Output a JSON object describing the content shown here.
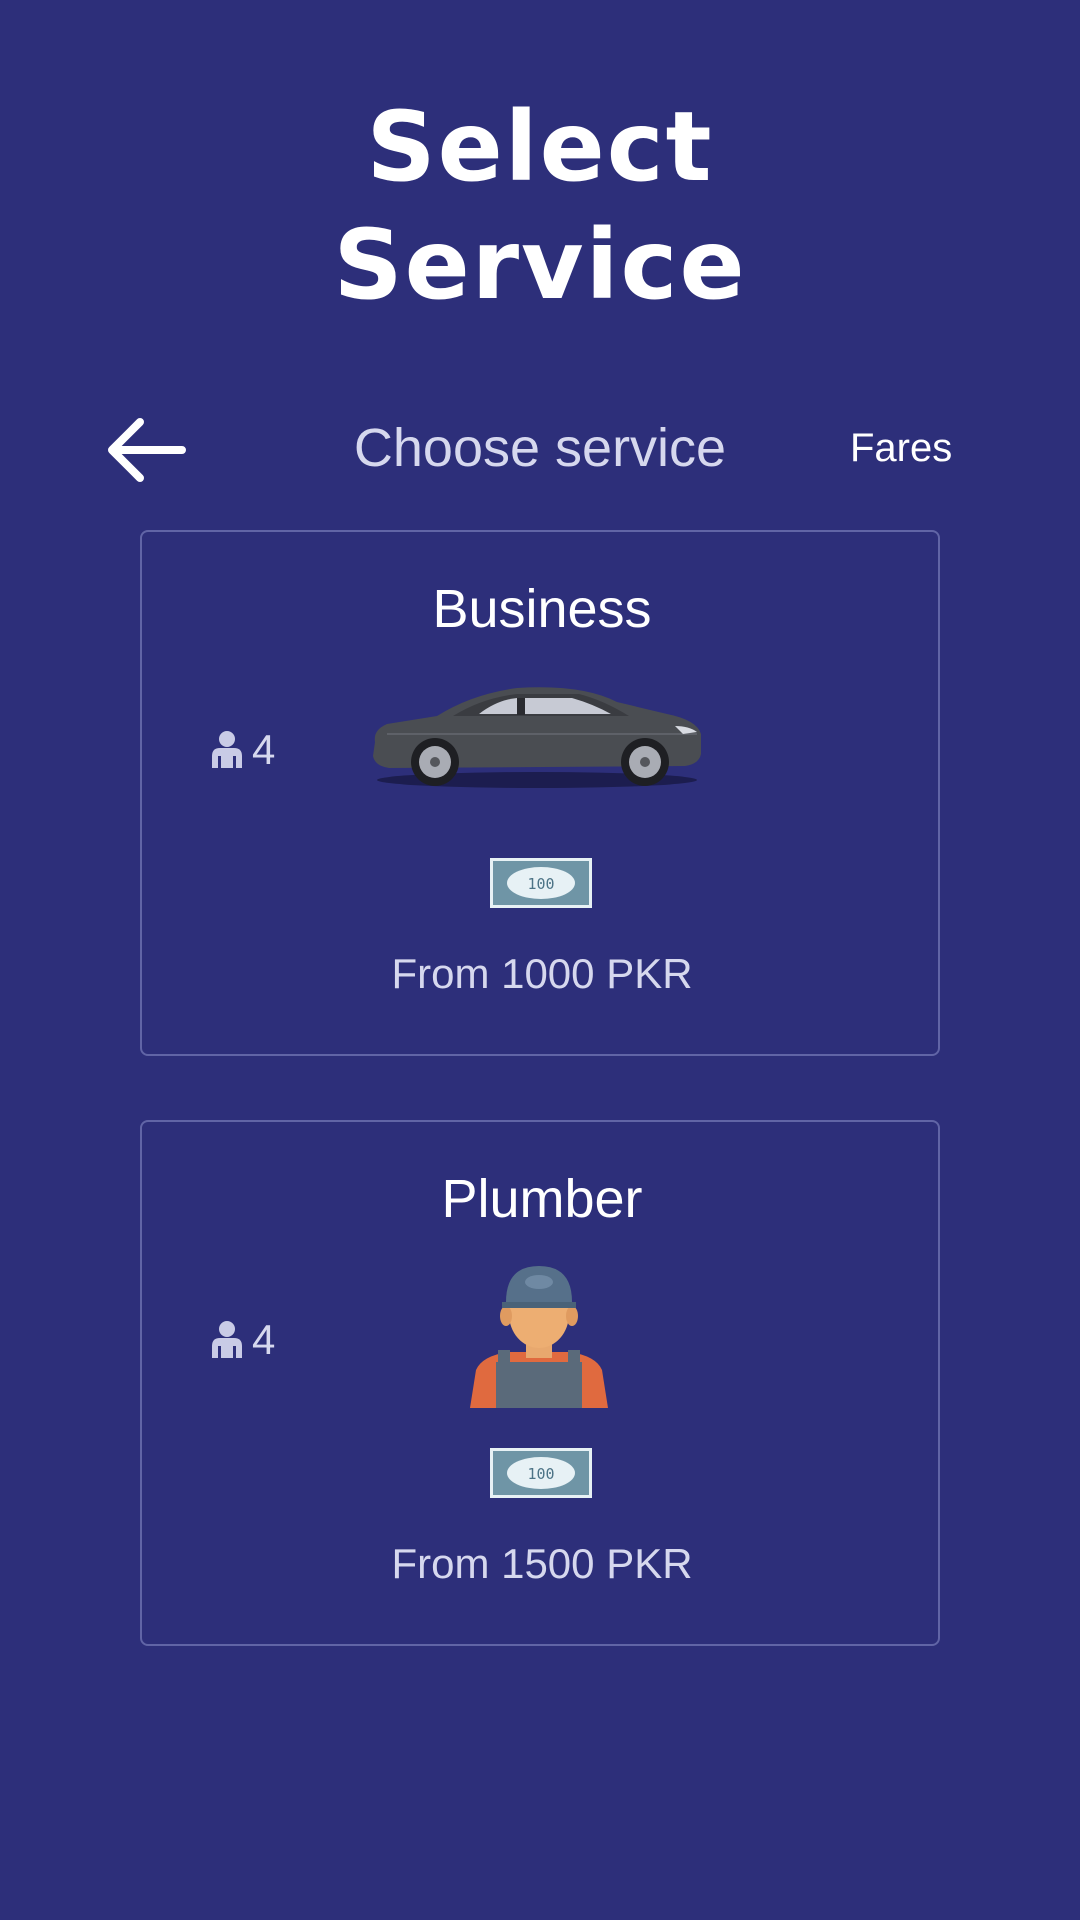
{
  "page": {
    "title_line1": "Select",
    "title_line2": "Service"
  },
  "header": {
    "back_icon": "arrow-left-icon",
    "title": "Choose service",
    "fares_label": "Fares"
  },
  "services": [
    {
      "name": "Business",
      "capacity": "4",
      "capacity_icon": "person-icon",
      "image": "car-image",
      "money_icon": "banknote-icon",
      "money_note_text": "100",
      "price": "From 1000 PKR"
    },
    {
      "name": "Plumber",
      "capacity": "4",
      "capacity_icon": "person-icon",
      "image": "plumber-image",
      "money_icon": "banknote-icon",
      "money_note_text": "100",
      "price": "From 1500 PKR"
    }
  ],
  "colors": {
    "background": "#2d2f7a",
    "card_border": "#6165a6",
    "primary_text": "#ffffff",
    "secondary_text": "#d6d8ee"
  }
}
